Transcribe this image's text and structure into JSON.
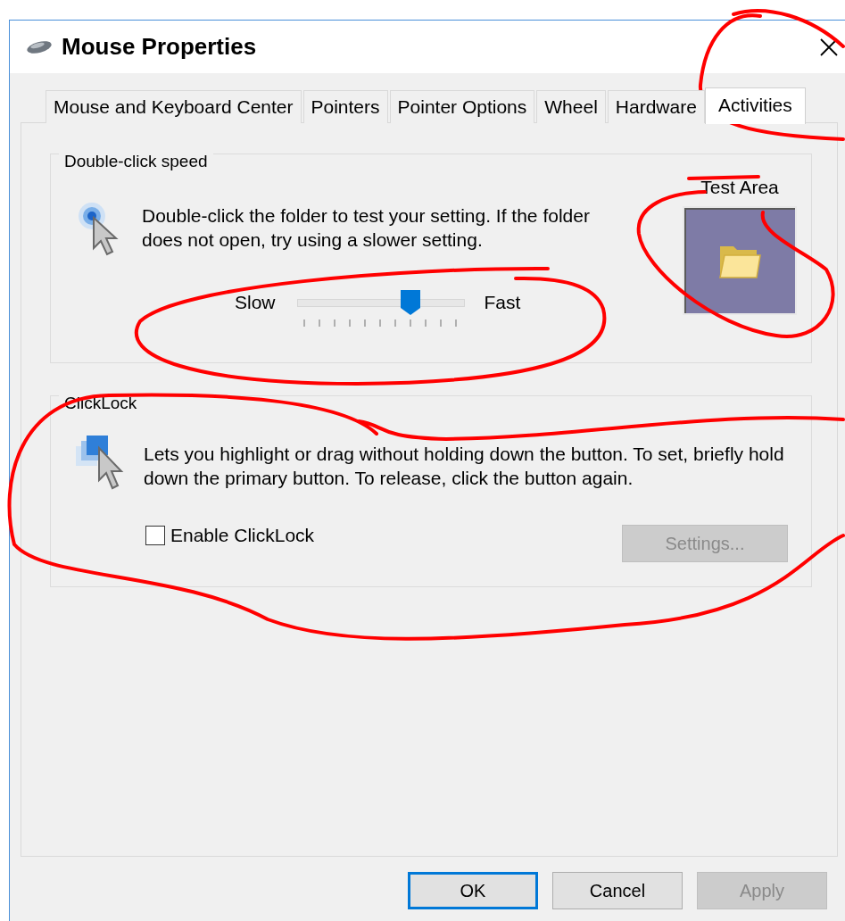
{
  "window": {
    "title": "Mouse Properties"
  },
  "tabs": [
    {
      "label": "Mouse and Keyboard Center",
      "selected": false
    },
    {
      "label": "Pointers",
      "selected": false
    },
    {
      "label": "Pointer Options",
      "selected": false
    },
    {
      "label": "Wheel",
      "selected": false
    },
    {
      "label": "Hardware",
      "selected": false
    },
    {
      "label": "Activities",
      "selected": true
    }
  ],
  "double_click_speed": {
    "legend": "Double-click speed",
    "description": "Double-click the folder to test your setting. If the folder does not open, try using a slower setting.",
    "slider": {
      "min_label": "Slow",
      "max_label": "Fast",
      "level": 0.68
    },
    "test_area": {
      "label": "Test Area"
    }
  },
  "clicklock": {
    "legend": "ClickLock",
    "description": "Lets you highlight or drag without holding down the button. To set, briefly hold down the primary button. To release, click the button again.",
    "checkbox": {
      "label": "Enable ClickLock",
      "checked": false
    },
    "settings_button": {
      "label": "Settings...",
      "disabled": true
    }
  },
  "buttons": [
    {
      "label": "OK",
      "default": true,
      "disabled": false
    },
    {
      "label": "Cancel",
      "default": false,
      "disabled": false
    },
    {
      "label": "Apply",
      "default": false,
      "disabled": true
    }
  ]
}
